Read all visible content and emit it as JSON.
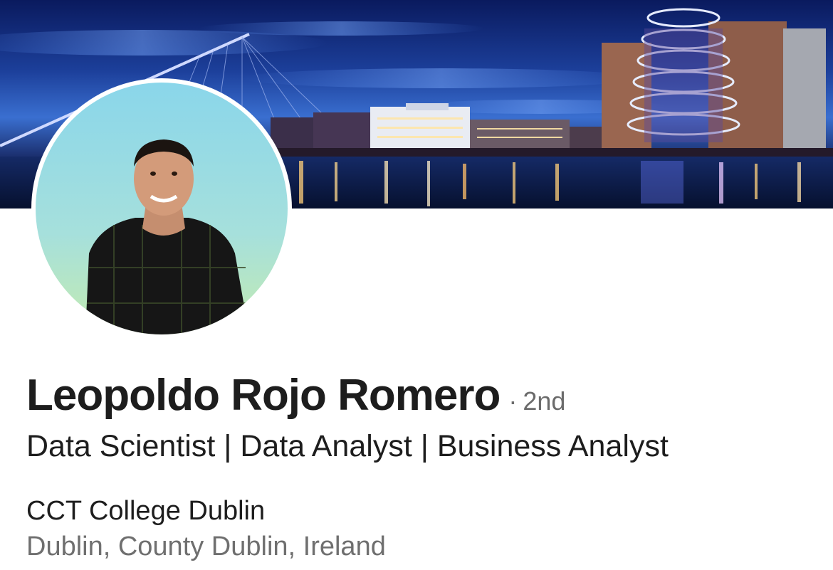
{
  "profile": {
    "name": "Leopoldo Rojo Romero",
    "separator": "·",
    "connection_degree": "2nd",
    "headline": "Data Scientist | Data Analyst | Business Analyst",
    "education": "CCT College Dublin",
    "location": "Dublin, County Dublin, Ireland"
  },
  "cover": {
    "sky_top": "#0b1f6b",
    "sky_bottom": "#2f5fc4",
    "water": "#0a1a45"
  },
  "avatar": {
    "bg_top": "#8fd8e8",
    "bg_bottom": "#b9e6b0"
  }
}
